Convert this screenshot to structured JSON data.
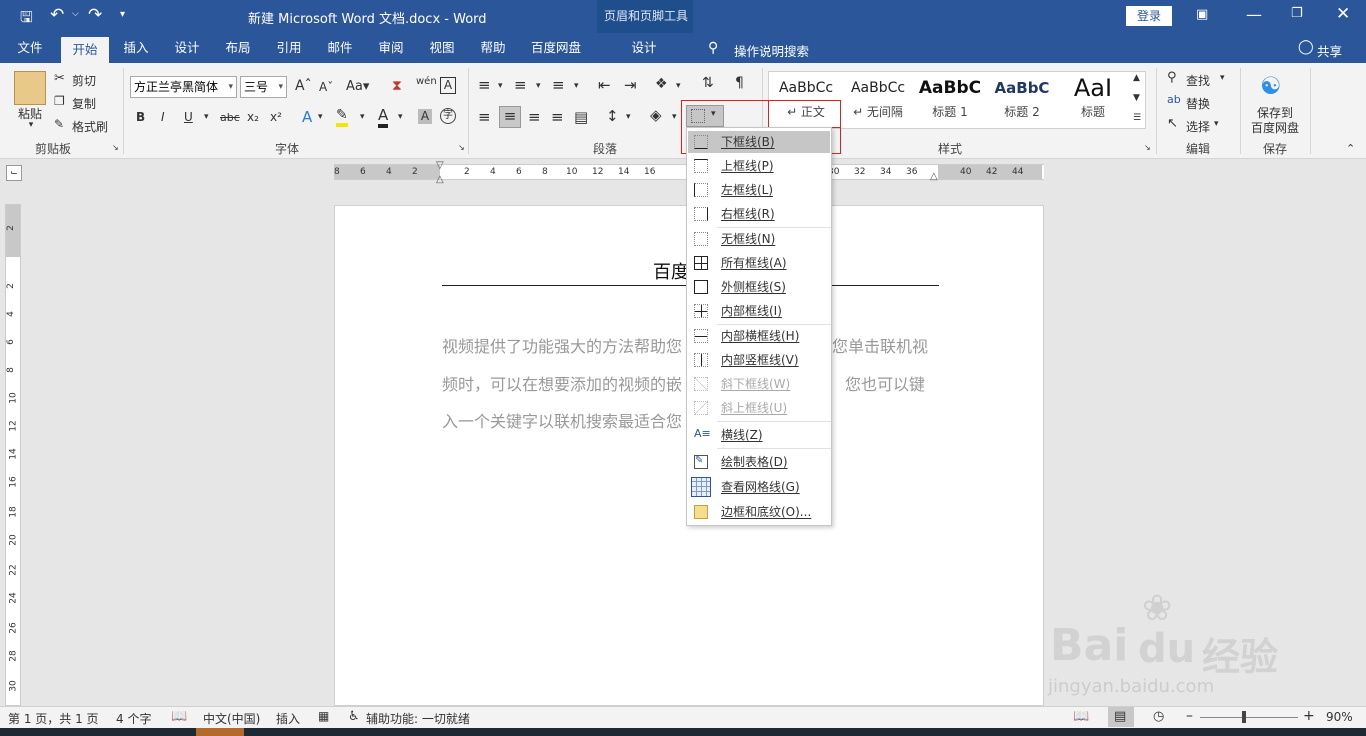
{
  "titlebar": {
    "doc_title": "新建 Microsoft Word 文档.docx  -  Word",
    "context_group": "页眉和页脚工具",
    "login_label": "登录"
  },
  "tabs": [
    "文件",
    "开始",
    "插入",
    "设计",
    "布局",
    "引用",
    "邮件",
    "审阅",
    "视图",
    "帮助",
    "百度网盘"
  ],
  "context_tab": "设计",
  "tell_me": "操作说明搜索",
  "share": "共享",
  "ribbon": {
    "clipboard": {
      "paste": "粘贴",
      "cut": "剪切",
      "copy": "复制",
      "format_painter": "格式刷",
      "group": "剪贴板"
    },
    "font": {
      "font_name": "方正兰亭黑简体",
      "font_size": "三号",
      "group": "字体",
      "bold": "B",
      "italic": "I",
      "underline": "U",
      "strike": "abc",
      "sub": "x₂",
      "sup": "x²"
    },
    "paragraph": {
      "group": "段落"
    },
    "styles": {
      "group": "样式",
      "items": [
        {
          "preview": "AaBbCc",
          "name": "↵ 正文"
        },
        {
          "preview": "AaBbCc",
          "name": "↵ 无间隔"
        },
        {
          "preview": "AaBbC",
          "name": "标题 1"
        },
        {
          "preview": "AaBbC",
          "name": "标题 2"
        },
        {
          "preview": "AaI",
          "name": "标题"
        }
      ]
    },
    "editing": {
      "find": "查找",
      "replace": "替换",
      "select": "选择",
      "group": "编辑"
    },
    "save": {
      "label1": "保存到",
      "label2": "百度网盘",
      "group": "保存"
    }
  },
  "ruler": {
    "h_ticks": [
      "8",
      "6",
      "4",
      "2",
      "2",
      "4",
      "6",
      "8",
      "10",
      "12",
      "14",
      "16",
      "30",
      "32",
      "34",
      "36",
      "40",
      "42",
      "44"
    ],
    "v_ticks": [
      "2",
      "2",
      "4",
      "6",
      "8",
      "10",
      "12",
      "14",
      "16",
      "18",
      "20",
      "22",
      "24",
      "26",
      "28",
      "30"
    ]
  },
  "document": {
    "header_text": "百度",
    "para_line1a": "视频提供了功能强大的方法帮助您",
    "para_line1b": "您单击联机视",
    "para_line2a": "频时，可以在想要添加的视频的嵌",
    "para_line2b": "您也可以键",
    "para_line3a": "入一个关键字以联机搜索最适合您"
  },
  "border_menu": {
    "items": [
      {
        "label": "下框线(B)",
        "highlighted": true,
        "disabled": false
      },
      {
        "label": "上框线(P)",
        "disabled": false
      },
      {
        "label": "左框线(L)",
        "disabled": false
      },
      {
        "label": "右框线(R)",
        "disabled": false
      },
      {
        "label": "无框线(N)",
        "disabled": false
      },
      {
        "label": "所有框线(A)",
        "disabled": false
      },
      {
        "label": "外侧框线(S)",
        "disabled": false
      },
      {
        "label": "内部框线(I)",
        "disabled": false
      },
      {
        "label": "内部横框线(H)",
        "disabled": false
      },
      {
        "label": "内部竖框线(V)",
        "disabled": false
      },
      {
        "label": "斜下框线(W)",
        "disabled": true
      },
      {
        "label": "斜上框线(U)",
        "disabled": true
      },
      {
        "label": "横线(Z)",
        "disabled": false
      },
      {
        "label": "绘制表格(D)",
        "disabled": false
      },
      {
        "label": "查看网格线(G)",
        "disabled": false
      },
      {
        "label": "边框和底纹(O)...",
        "disabled": false
      }
    ]
  },
  "statusbar": {
    "page": "第 1 页，共 1 页",
    "words": "4 个字",
    "lang": "中文(中国)",
    "mode": "插入",
    "accessibility": "辅助功能: 一切就绪",
    "zoom": "90%"
  },
  "watermark": {
    "text1": "Bai",
    "text2": "经验",
    "url": "jingyan.baidu.com"
  },
  "colors": {
    "accent": "#2b579a",
    "highlight": "#c6c6c6",
    "redbox": "#e02020"
  }
}
